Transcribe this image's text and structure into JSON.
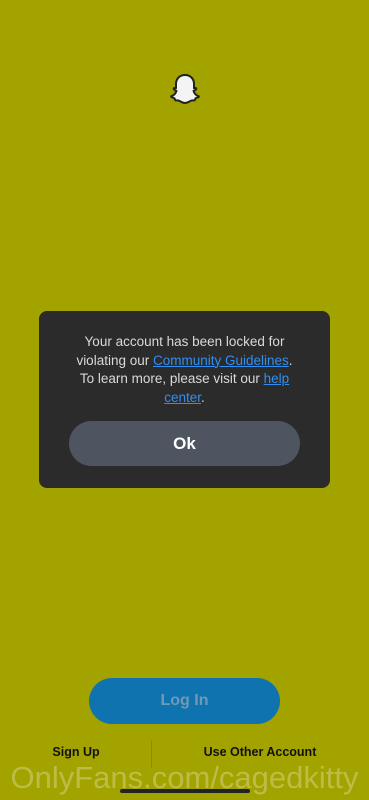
{
  "brand_color": "#a3a300",
  "app_logo": "snapchat-ghost-icon",
  "dialog": {
    "message_line1": "Your account has been locked for",
    "message_line2_prefix": "violating our ",
    "community_guidelines_link": "Community Guidelines",
    "message_line2_suffix": ".",
    "message_line3_prefix": "To learn more, please visit our ",
    "help_link_part1": "help",
    "help_link_part2": "center",
    "message_line4_suffix": ".",
    "ok_label": "Ok"
  },
  "actions": {
    "login_label": "Log In",
    "signup_label": "Sign Up",
    "other_account_label": "Use Other Account"
  },
  "watermark": "OnlyFans.com/cagedkitty"
}
